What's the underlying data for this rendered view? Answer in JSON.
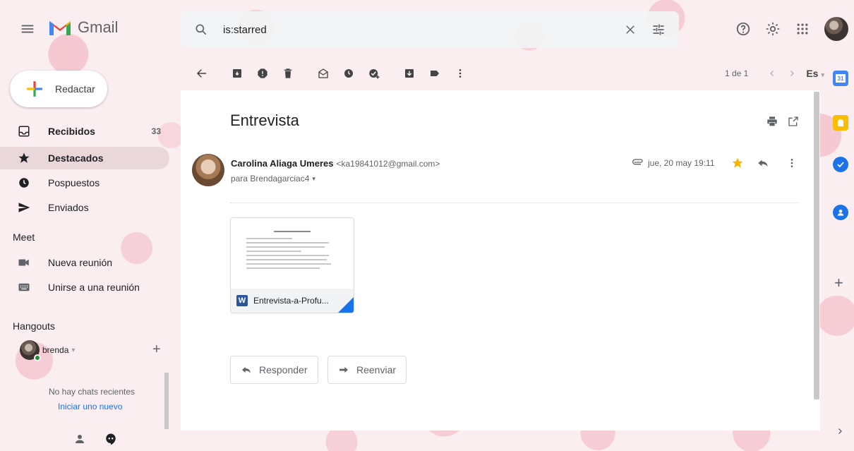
{
  "header": {
    "app_name": "Gmail",
    "search_value": "is:starred"
  },
  "sidebar": {
    "compose_label": "Redactar",
    "items": [
      {
        "label": "Recibidos",
        "count": "33"
      },
      {
        "label": "Destacados"
      },
      {
        "label": "Pospuestos"
      },
      {
        "label": "Enviados"
      }
    ],
    "meet_title": "Meet",
    "meet_items": [
      {
        "label": "Nueva reunión"
      },
      {
        "label": "Unirse a una reunión"
      }
    ],
    "hangouts_title": "Hangouts",
    "hangouts_user": "brenda",
    "no_chats": "No hay chats recientes",
    "start_new": "Iniciar uno nuevo"
  },
  "toolbar": {
    "pagination": "1 de 1",
    "language": "Es"
  },
  "email": {
    "subject": "Entrevista",
    "sender_name": "Carolina Aliaga Umeres",
    "sender_email": "<ka19841012@gmail.com>",
    "to": "para Brendagarciac4",
    "date": "jue, 20 may 19:11",
    "attachment_name": "Entrevista-a-Profu...",
    "attachment_type_letter": "W",
    "reply_label": "Responder",
    "forward_label": "Reenviar"
  },
  "colors": {
    "accent_blue": "#1a73e8",
    "star": "#f4b400",
    "word_blue": "#2b579a"
  }
}
